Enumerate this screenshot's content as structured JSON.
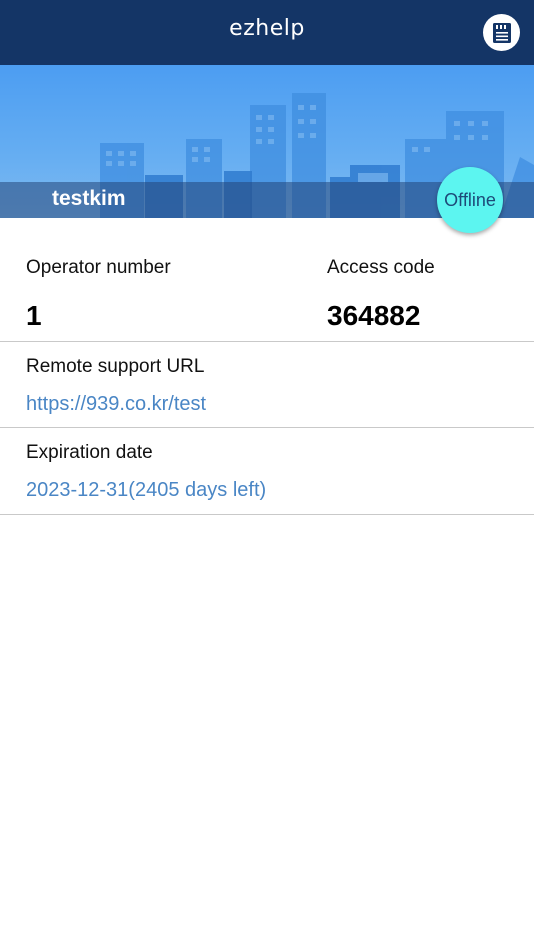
{
  "header": {
    "title": "ezhelp",
    "menu_icon": "document-icon"
  },
  "profile": {
    "name": "testkim",
    "status": "Offline",
    "status_color": "#5cf5f0"
  },
  "info": {
    "operator_label": "Operator number",
    "operator_value": "1",
    "access_label": "Access code",
    "access_value": "364882",
    "url_label": "Remote support URL",
    "url_value": "https://939.co.kr/test",
    "expiration_label": "Expiration date",
    "expiration_value": "2023-12-31(2405 days left)"
  },
  "colors": {
    "header_bg": "#143566",
    "link": "#4a86c5"
  }
}
